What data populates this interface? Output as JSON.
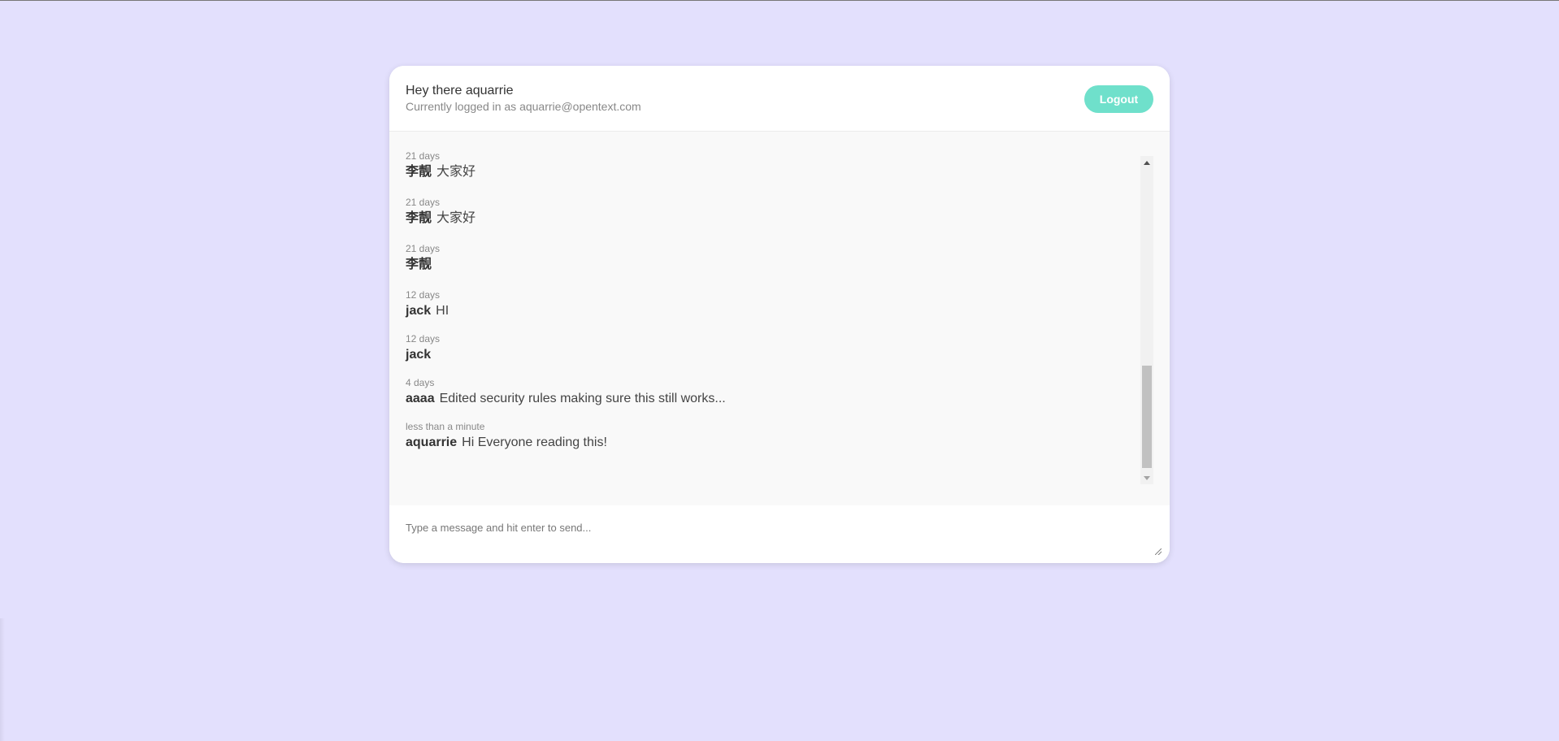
{
  "header": {
    "greeting": "Hey there aquarrie",
    "subtitle": "Currently logged in as aquarrie@opentext.com",
    "logout_label": "Logout"
  },
  "messages": [
    {
      "time": "21 days",
      "author": "李靓",
      "text": "大家好"
    },
    {
      "time": "21 days",
      "author": "李靓",
      "text": "大家好"
    },
    {
      "time": "21 days",
      "author": "李靓",
      "text": ""
    },
    {
      "time": "12 days",
      "author": "jack",
      "text": "HI"
    },
    {
      "time": "12 days",
      "author": "jack",
      "text": ""
    },
    {
      "time": "4 days",
      "author": "aaaa",
      "text": "Edited security rules making sure this still works..."
    },
    {
      "time": "less than a minute",
      "author": "aquarrie",
      "text": "Hi Everyone reading this!"
    }
  ],
  "composer": {
    "placeholder": "Type a message and hit enter to send..."
  },
  "colors": {
    "background": "#e3e0fd",
    "accent": "#6fe0cb",
    "card": "#ffffff",
    "messages_background": "#f9f9f9"
  },
  "icons": {
    "scroll_up": "scroll-up-arrow-icon",
    "scroll_down": "scroll-down-arrow-icon",
    "resize": "resize-grip-icon"
  }
}
